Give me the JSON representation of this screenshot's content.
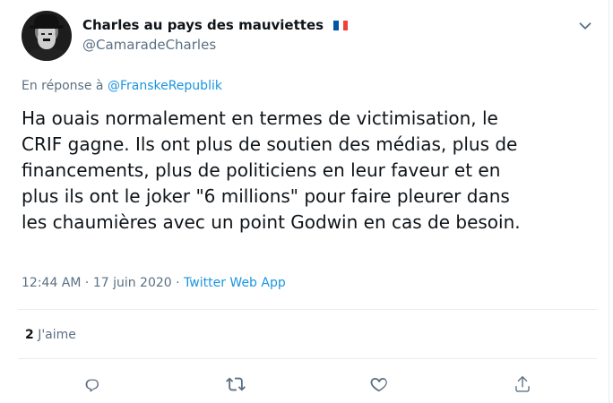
{
  "author": {
    "display_name": "Charles au pays des mauviettes",
    "flag_emoji": "🇫🇷",
    "handle": "@CamaradeCharles"
  },
  "reply_to": {
    "prefix": "En réponse à",
    "handle": "@FranskeRepublik"
  },
  "tweet": {
    "lines": [
      "Ha ouais normalement en termes de victimisation, le",
      "CRIF gagne. Ils ont plus de soutien des médias, plus de",
      "financements, plus de politiciens en leur faveur et en",
      "plus ils ont le joker \"6 millions\" pour faire pleurer dans",
      "les chaumières avec un point Godwin en cas de besoin."
    ]
  },
  "meta": {
    "time": "12:44 AM",
    "separator": "·",
    "date": "17 juin 2020",
    "source": "Twitter Web App"
  },
  "stats": {
    "likes_count": "2",
    "likes_label": "J'aime"
  },
  "actions": {
    "icons": [
      "reply-icon",
      "retweet-icon",
      "like-icon",
      "share-icon"
    ]
  },
  "colors": {
    "text": "#0f1419",
    "secondary": "#5b7083",
    "link": "#1b95e0",
    "divider": "#e6ecf0"
  }
}
